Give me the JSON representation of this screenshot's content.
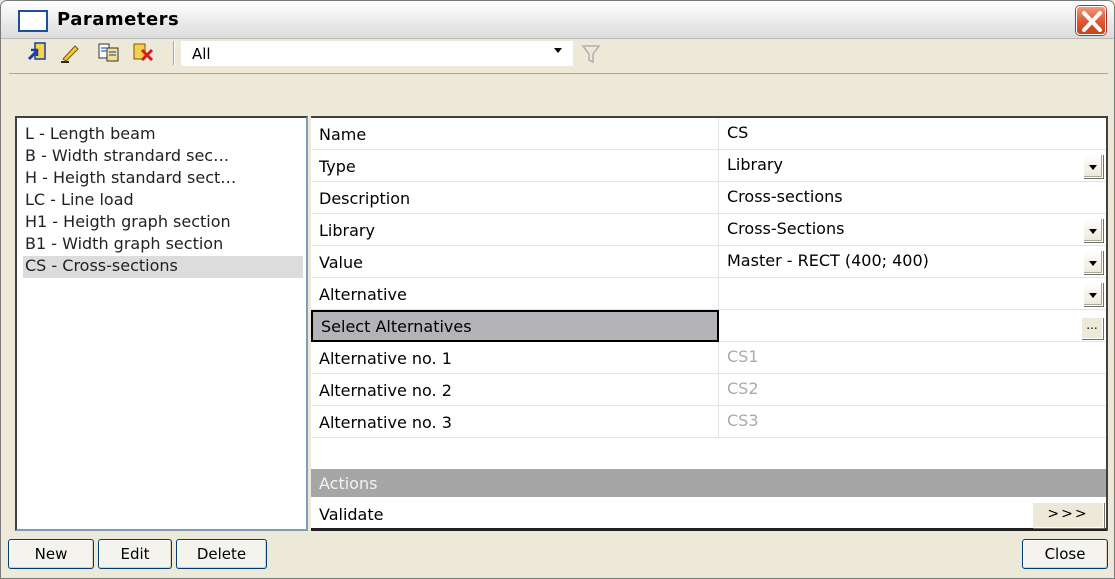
{
  "window": {
    "title": "Parameters"
  },
  "toolbar": {
    "filter_value": "All",
    "icons": [
      "new-parameter-icon",
      "edit-parameter-icon",
      "copy-parameter-icon",
      "delete-parameter-icon",
      "filter-icon"
    ]
  },
  "parameter_list": {
    "items": [
      "L - Length beam",
      "B - Width strandard sec…",
      "H - Heigth standard sect…",
      "LC - Line load",
      "H1 - Heigth graph section",
      "B1 - Width graph section",
      "CS - Cross-sections"
    ],
    "selected_index": 6
  },
  "properties": {
    "rows": [
      {
        "key": "Name",
        "value": "CS"
      },
      {
        "key": "Type",
        "value": "Library"
      },
      {
        "key": "Description",
        "value": "Cross-sections"
      },
      {
        "key": "Library",
        "value": "Cross-Sections"
      },
      {
        "key": "Value",
        "value": "Master - RECT (400; 400)"
      },
      {
        "key": "Alternative",
        "value": ""
      },
      {
        "key": "Select Alternatives",
        "value": ""
      },
      {
        "key": "Alternative no. 1",
        "value": "CS1"
      },
      {
        "key": "Alternative no. 2",
        "value": "CS2"
      },
      {
        "key": "Alternative no. 3",
        "value": "CS3"
      }
    ],
    "dots_label": "...",
    "actions_header": "Actions",
    "validate_label": "Validate",
    "run_label": ">>>"
  },
  "buttons": {
    "new": "New",
    "edit": "Edit",
    "delete": "Delete",
    "close": "Close"
  }
}
